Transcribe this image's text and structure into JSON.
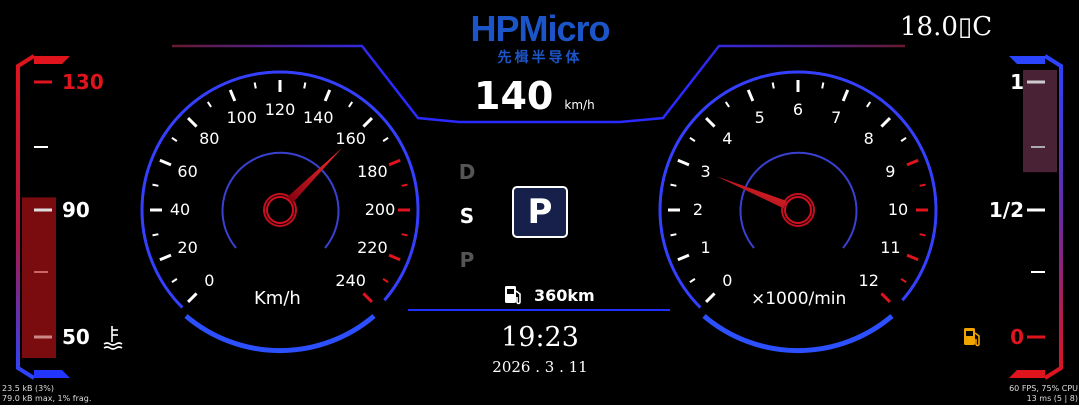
{
  "brand": {
    "logo_text": "HPMicro",
    "logo_cn": "先楫半导体"
  },
  "temperature": {
    "value": "18.0",
    "glyph": "▯",
    "unit": "C"
  },
  "speed": {
    "value": "140",
    "unit": "km/h"
  },
  "speedometer": {
    "ticks": [
      "0",
      "20",
      "40",
      "60",
      "80",
      "100",
      "120",
      "140",
      "160",
      "180",
      "200",
      "220",
      "240"
    ],
    "unit": "Km/h",
    "needle_value": 160,
    "max": 240
  },
  "tachometer": {
    "ticks": [
      "0",
      "1",
      "2",
      "3",
      "4",
      "5",
      "6",
      "7",
      "8",
      "9",
      "10",
      "11",
      "12"
    ],
    "unit": "×1000/min",
    "needle_value": 3,
    "max": 12
  },
  "gears": {
    "items": [
      "D",
      "S",
      "P"
    ],
    "active": "P"
  },
  "range": {
    "value": "360km"
  },
  "clock": {
    "time": "19:23",
    "date": "2026 . 3 . 11"
  },
  "coolant_gauge": {
    "labels": [
      "130",
      "90",
      "50"
    ],
    "level_fraction": 0.55
  },
  "fuel_gauge": {
    "labels": [
      "1",
      "1/2",
      "0"
    ],
    "level_fraction": 0.5
  },
  "stats_left": {
    "line1": "23.5 kB (3%)",
    "line2": "79.0 kB max, 1% frag."
  },
  "stats_right": {
    "line1": "60 FPS, 75% CPU",
    "line2": "13 ms (5 | 8)"
  },
  "colors": {
    "accent_blue": "#2f56ff",
    "accent_red": "#e0141c",
    "fuel_icon": "#f0a400"
  }
}
